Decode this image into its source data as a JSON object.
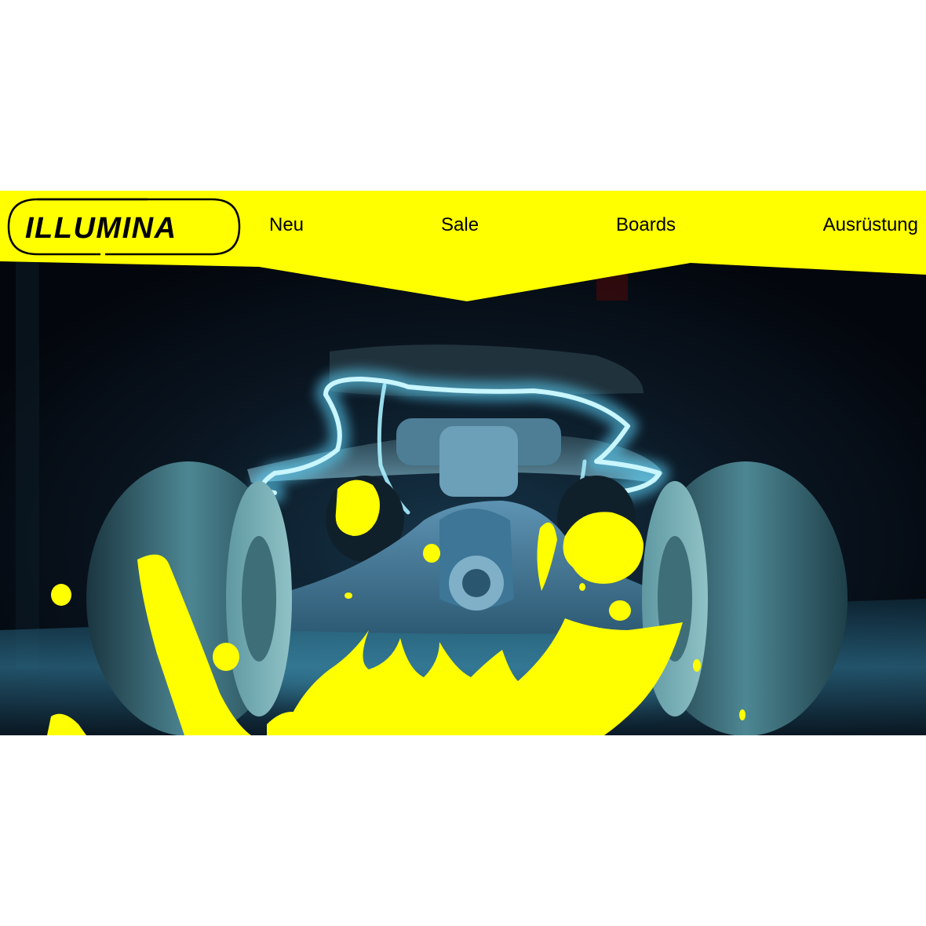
{
  "brand": {
    "logo_text": "ILLUMINA"
  },
  "nav": {
    "items": [
      {
        "label": "Neu"
      },
      {
        "label": "Sale"
      },
      {
        "label": "Boards"
      },
      {
        "label": "Ausrüstung"
      }
    ]
  },
  "hero": {
    "image_subject": "longboard-truck-with-neon-light",
    "neon_color": "#7fe6ff"
  },
  "colors": {
    "accent_yellow": "#ffff00",
    "background": "#ffffff",
    "hero_dark": "#050912"
  }
}
